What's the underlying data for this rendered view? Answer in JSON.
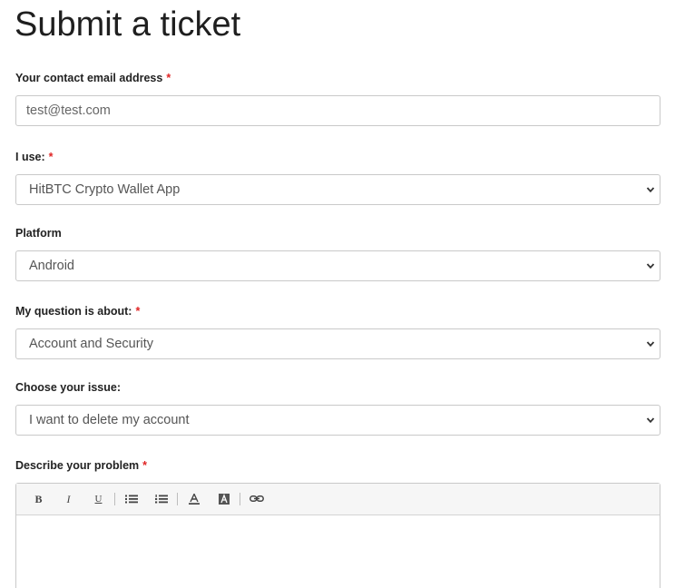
{
  "page": {
    "title": "Submit a ticket"
  },
  "form": {
    "email": {
      "label": "Your contact email address",
      "required_mark": "*",
      "value": "test@test.com"
    },
    "product": {
      "label": "I use:",
      "required_mark": "*",
      "value": "HitBTC Crypto Wallet App"
    },
    "platform": {
      "label": "Platform",
      "value": "Android"
    },
    "topic": {
      "label": "My question is about:",
      "required_mark": "*",
      "value": "Account and Security"
    },
    "issue": {
      "label": "Choose your issue:",
      "value": "I want to delete my account"
    },
    "description": {
      "label": "Describe your problem",
      "required_mark": "*",
      "value": ""
    }
  },
  "editor_toolbar": {
    "bold_label": "B",
    "italic_label": "I",
    "underline_label": "U",
    "buttons": [
      "bold-icon",
      "italic-icon",
      "underline-icon",
      "bulleted-list-icon",
      "numbered-list-icon",
      "text-color-icon",
      "background-color-icon",
      "link-icon"
    ]
  },
  "colors": {
    "required": "#e02424",
    "border": "#c9c9c9",
    "toolbar_bg": "#f6f6f6"
  }
}
